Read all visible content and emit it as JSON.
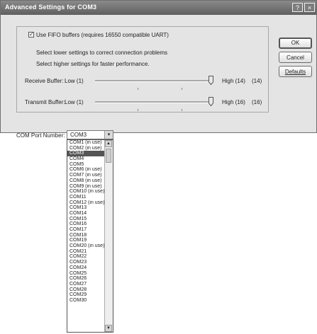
{
  "window": {
    "title": "Advanced Settings for COM3",
    "help_label": "?",
    "close_label": "×"
  },
  "options": {
    "fifo_checked": true,
    "fifo_label": "Use FIFO buffers (requires 16550 compatible UART)",
    "lower_hint": "Select lower settings to correct connection problems",
    "higher_hint": "Select higher settings for faster performance.",
    "receive": {
      "label": "Receive Buffer:",
      "low": "Low (1)",
      "high": "High (14)",
      "value": "(14)",
      "level": 1.0
    },
    "transmit": {
      "label": "Transmit Buffer:",
      "low": "Low (1)",
      "high": "High (16)",
      "value": "(16)",
      "level": 1.0
    }
  },
  "buttons": {
    "ok": "OK",
    "cancel": "Cancel",
    "defaults": "Defaults"
  },
  "port": {
    "label": "COM Port Number:",
    "selected": "COM3",
    "arrow": "▾",
    "items": [
      "COM1 (in use)",
      "COM2 (in use)",
      "COM3",
      "COM4",
      "COM5",
      "COM6 (in use)",
      "COM7 (in use)",
      "COM8 (in use)",
      "COM9 (in use)",
      "COM10 (in use)",
      "COM11",
      "COM12 (in use)",
      "COM13",
      "COM14",
      "COM15",
      "COM16",
      "COM17",
      "COM18",
      "COM19",
      "COM20 (in use)",
      "COM21",
      "COM22",
      "COM23",
      "COM24",
      "COM25",
      "COM26",
      "COM27",
      "COM28",
      "COM29",
      "COM30"
    ],
    "selected_index": 2
  }
}
